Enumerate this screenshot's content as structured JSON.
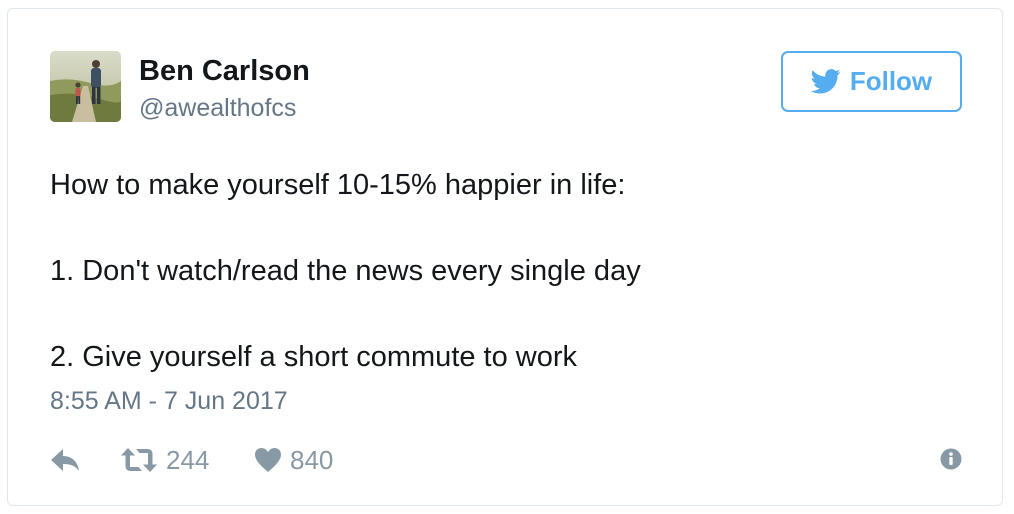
{
  "author": {
    "name": "Ben Carlson",
    "handle": "@awealthofcs"
  },
  "follow_button": {
    "label": "Follow",
    "icon": "twitter-bird-icon"
  },
  "tweet": {
    "lines": [
      "How to make yourself 10-15% happier in life:",
      "1. Don't watch/read the news every single day",
      "2. Give yourself a short commute to work"
    ],
    "timestamp": "8:55 AM - 7 Jun 2017"
  },
  "actions": {
    "reply_icon": "reply-icon",
    "retweet_icon": "retweet-icon",
    "retweet_count": "244",
    "like_icon": "heart-icon",
    "like_count": "840",
    "info_icon": "info-icon"
  },
  "colors": {
    "accent": "#55acee",
    "text": "#14171a",
    "muted": "#657786",
    "action": "#8899a6",
    "border": "#e1e8ed"
  }
}
